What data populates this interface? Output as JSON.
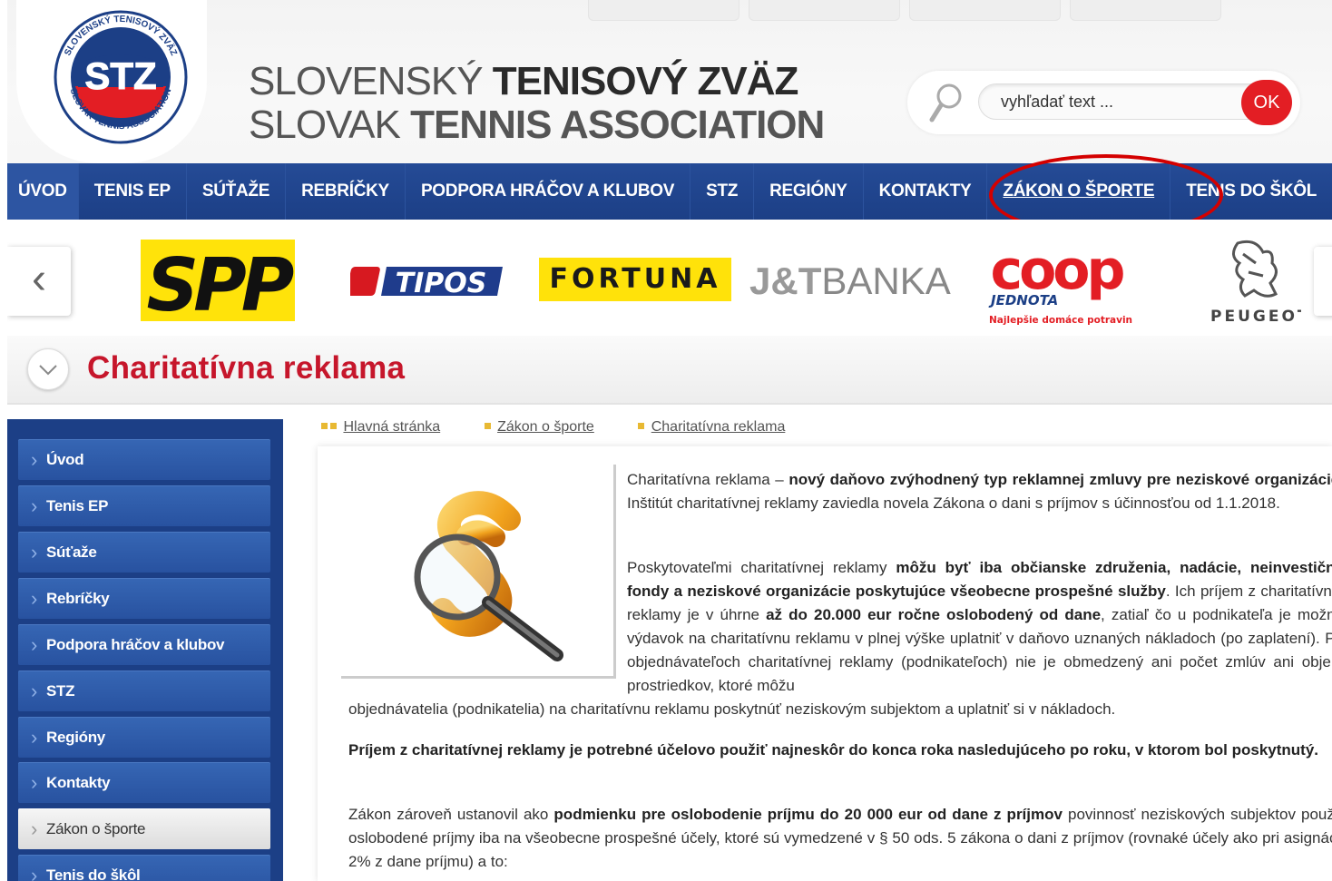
{
  "brand": {
    "name_sk_light": "SLOVENSKÝ",
    "name_sk_bold": "TENISOVÝ ZVÄZ",
    "name_en_light": "SLOVAK",
    "name_en_bold": "TENNIS ASSOCIATION",
    "logo_text": "STZ",
    "logo_ring_top": "SLOVENSKÝ TENISOVÝ ZVÄZ",
    "logo_ring_bottom": "SLOVAK TENNIS ASSOCIATION"
  },
  "search": {
    "placeholder": "vyhľadať text ...",
    "button_label": "OK"
  },
  "nav": {
    "items": [
      {
        "label": "ÚVOD"
      },
      {
        "label": "TENIS EP"
      },
      {
        "label": "SÚŤAŽE"
      },
      {
        "label": "REBRÍČKY"
      },
      {
        "label": "PODPORA HRÁČOV A KLUBOV"
      },
      {
        "label": "STZ"
      },
      {
        "label": "REGIÓNY"
      },
      {
        "label": "KONTAKTY"
      },
      {
        "label": "ZÁKON O ŠPORTE"
      },
      {
        "label": "TENIS DO ŠKÔL"
      }
    ],
    "active_index": 8
  },
  "sponsors": {
    "spp": "SPP",
    "tipos": "TIPOS",
    "fortuna": "FORTUNA",
    "jt_bold": "J&T",
    "jt_light": "BANKA",
    "coop": "coop",
    "coop_sub": "JEDNOTA",
    "coop_tagline": "Najlepšie domáce potraviny",
    "peugeot": "PEUGEOT",
    "prev_arrow": "‹"
  },
  "page": {
    "title": "Charitatívna reklama"
  },
  "sidebar": {
    "items": [
      {
        "label": "Úvod"
      },
      {
        "label": "Tenis EP"
      },
      {
        "label": "Súťaže"
      },
      {
        "label": "Rebríčky"
      },
      {
        "label": "Podpora hráčov a klubov"
      },
      {
        "label": "STZ"
      },
      {
        "label": "Regióny"
      },
      {
        "label": "Kontakty"
      },
      {
        "label": "Zákon o športe"
      },
      {
        "label": "Tenis do škôl"
      }
    ],
    "active_index": 8
  },
  "breadcrumb": [
    {
      "label": "Hlavná stránka"
    },
    {
      "label": "Zákon o športe"
    },
    {
      "label": "Charitatívna reklama"
    }
  ],
  "article": {
    "p1_a": "Charitatívna reklama – ",
    "p1_b": "nový daňovo zvýhodnený typ reklamnej zmluvy pre neziskové organizácie",
    "p1_c": ". Inštitút charitatívnej reklamy zaviedla novela Zákona o dani s príjmov s účinnosťou od 1.1.2018.",
    "p2_a": "Poskytovateľmi charitatívnej reklamy ",
    "p2_b": "môžu byť iba občianske združenia, nadácie, neinvestičné fondy a neziskové organizácie poskytujúce všeobecne prospešné služby",
    "p2_c": ". Ich príjem z charitatívnej reklamy je v úhrne ",
    "p2_d": "až do 20.000 eur ročne oslobodený od dane",
    "p2_e": ", zatiaľ čo u podnikateľa je možné výdavok na charitatívnu reklamu v plnej výške uplatniť v daňovo uznaných nákladoch (po zaplatení). Pri objednávateľoch charitatívnej reklamy (podnikateľoch) nie je obmedzený ani počet zmlúv ani objem prostriedkov, ktoré môžu",
    "p2_f": "objednávatelia (podnikatelia) na charitatívnu reklamu poskytnúť neziskovým subjektom a uplatniť si v nákladoch.",
    "p3": "Príjem z charitatívnej reklamy je potrebné účelovo použiť najneskôr do konca roka nasledujúceho po roku, v ktorom bol poskytnutý.",
    "p4_a": "Zákon zároveň ustanovil ako ",
    "p4_b": "podmienku pre oslobodenie príjmu do 20 000 eur od dane z príjmov",
    "p4_c": " povinnosť neziskových subjektov použiť oslobodené príjmy iba na všeobecne prospešné účely, ktoré sú vymedzené v § 50 ods. 5 zákona o dani z príjmov (rovnaké účely ako pri asignácii 2% z dane príjmu) a to:"
  },
  "colors": {
    "nav_blue": "#1c3f86",
    "title_red": "#c6162b",
    "ok_red": "#e31e24",
    "annotation_red": "#d40000"
  }
}
